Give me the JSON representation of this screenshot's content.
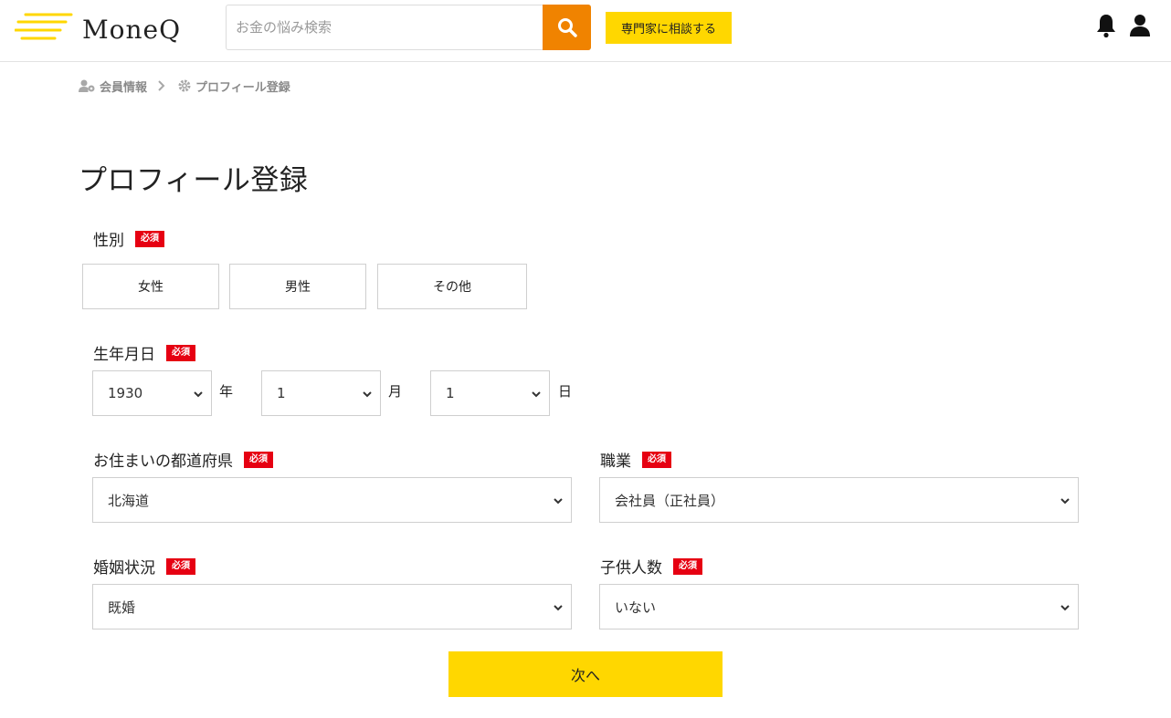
{
  "header": {
    "logo_text": "MoneQ",
    "search_placeholder": "お金の悩み検索",
    "consult_label": "専門家に相談する",
    "colors": {
      "accent_yellow": "#ffd700",
      "search_orange": "#f08300",
      "required_red": "#e60012"
    }
  },
  "breadcrumb": {
    "items": [
      "会員情報",
      "プロフィール登録"
    ]
  },
  "page": {
    "title": "プロフィール登録",
    "required_label": "必須"
  },
  "gender": {
    "label": "性別",
    "options": [
      "女性",
      "男性",
      "その他"
    ]
  },
  "birthdate": {
    "label": "生年月日",
    "year": "1930",
    "year_unit": "年",
    "month": "1",
    "month_unit": "月",
    "day": "1",
    "day_unit": "日"
  },
  "prefecture": {
    "label": "お住まいの都道府県",
    "value": "北海道"
  },
  "occupation": {
    "label": "職業",
    "value": "会社員（正社員）"
  },
  "marital": {
    "label": "婚姻状況",
    "value": "既婚"
  },
  "children": {
    "label": "子供人数",
    "value": "いない"
  },
  "next_label": "次へ"
}
